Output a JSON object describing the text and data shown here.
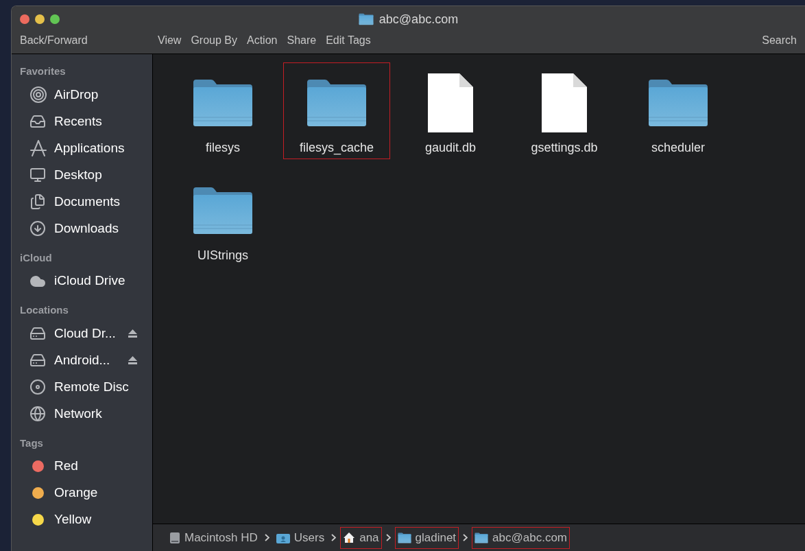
{
  "window": {
    "title": "abc@abc.com"
  },
  "toolbar": {
    "nav": "Back/Forward",
    "actions": [
      "View",
      "Group By",
      "Action",
      "Share",
      "Edit Tags"
    ],
    "search": "Search"
  },
  "sidebar": {
    "sections": [
      {
        "title": "Favorites",
        "items": [
          {
            "label": "AirDrop",
            "kind": "airdrop"
          },
          {
            "label": "Recents",
            "kind": "recents"
          },
          {
            "label": "Applications",
            "kind": "apps"
          },
          {
            "label": "Desktop",
            "kind": "desktop"
          },
          {
            "label": "Documents",
            "kind": "documents"
          },
          {
            "label": "Downloads",
            "kind": "downloads"
          }
        ]
      },
      {
        "title": "iCloud",
        "items": [
          {
            "label": "iCloud Drive",
            "kind": "cloud"
          }
        ]
      },
      {
        "title": "Locations",
        "items": [
          {
            "label": "Cloud Dr...",
            "kind": "drive",
            "ejectable": true
          },
          {
            "label": "Android...",
            "kind": "disk",
            "ejectable": true
          },
          {
            "label": "Remote Disc",
            "kind": "disc",
            "ejectable": false
          },
          {
            "label": "Network",
            "kind": "network",
            "ejectable": false
          }
        ]
      },
      {
        "title": "Tags",
        "items": [
          {
            "label": "Red",
            "kind": "tag",
            "color": "#ec6b62"
          },
          {
            "label": "Orange",
            "kind": "tag",
            "color": "#f0ad4e"
          },
          {
            "label": "Yellow",
            "kind": "tag",
            "color": "#f6d84a"
          }
        ]
      }
    ]
  },
  "files": [
    {
      "name": "filesys",
      "kind": "folder",
      "highlighted": false
    },
    {
      "name": "filesys_cache",
      "kind": "folder",
      "highlighted": true
    },
    {
      "name": "gaudit.db",
      "kind": "document",
      "highlighted": false
    },
    {
      "name": "gsettings.db",
      "kind": "document",
      "highlighted": false
    },
    {
      "name": "scheduler",
      "kind": "folder",
      "highlighted": false
    },
    {
      "name": "UIStrings",
      "kind": "folder",
      "highlighted": false
    }
  ],
  "path_bar": [
    {
      "label": "Macintosh HD",
      "kind": "disk",
      "highlighted": false
    },
    {
      "label": "Users",
      "kind": "users",
      "highlighted": false
    },
    {
      "label": "ana",
      "kind": "home",
      "highlighted": true
    },
    {
      "label": "gladinet",
      "kind": "folder",
      "highlighted": true
    },
    {
      "label": "abc@abc.com",
      "kind": "folder",
      "highlighted": true
    }
  ]
}
